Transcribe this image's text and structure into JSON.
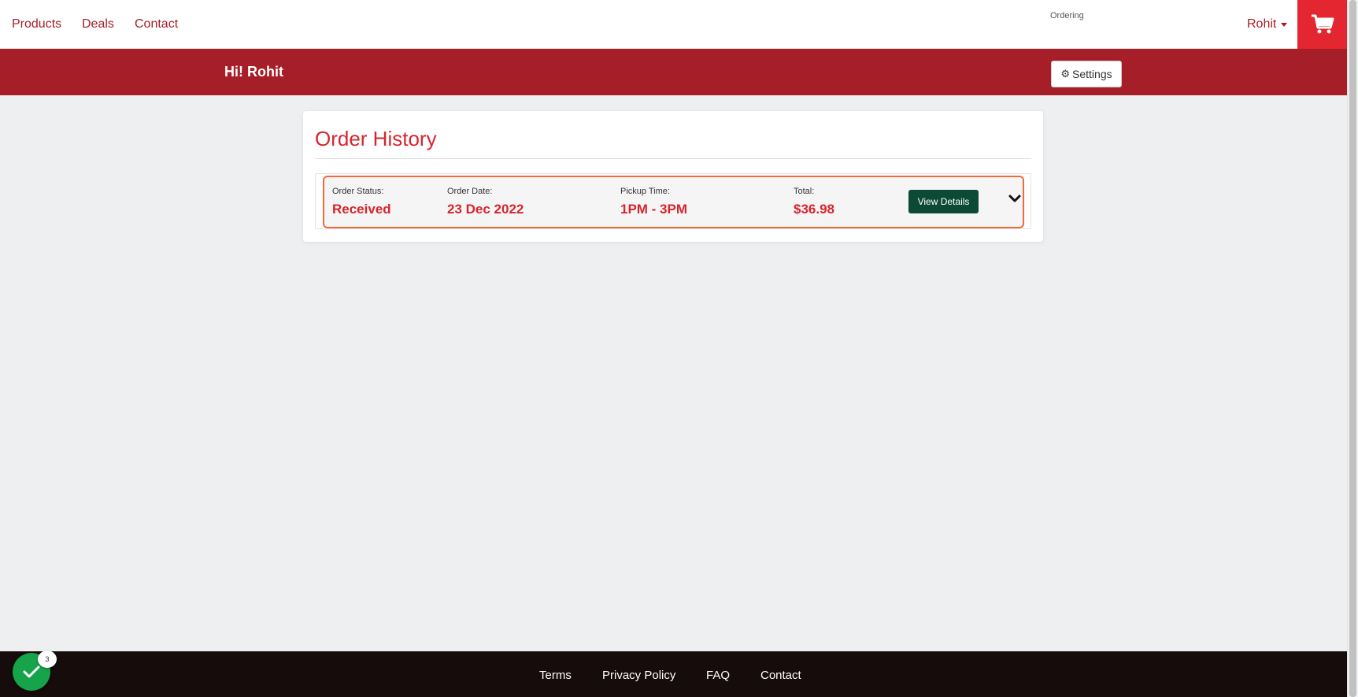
{
  "nav": {
    "links": [
      "Products",
      "Deals",
      "Contact"
    ],
    "ordering_label": "Ordering",
    "user_name": "Rohit",
    "cart_icon": "shopping-cart-icon"
  },
  "banner": {
    "greeting": "Hi! Rohit",
    "settings_label": "Settings"
  },
  "card": {
    "title": "Order History",
    "order": {
      "status_label": "Order Status:",
      "status_value": "Received",
      "date_label": "Order Date:",
      "date_value": "23 Dec 2022",
      "pickup_label": "Pickup Time:",
      "pickup_value": "1PM - 3PM",
      "total_label": "Total:",
      "total_value": "$36.98",
      "view_details_label": "View Details"
    }
  },
  "footer": {
    "links": [
      "Terms",
      "Privacy Policy",
      "FAQ",
      "Contact"
    ]
  },
  "widget": {
    "badge_count": "3"
  },
  "colors": {
    "brand_red": "#a61e27",
    "accent_red": "#d6252e",
    "cart_red": "#e3262f",
    "highlight_orange": "#f06a3b",
    "button_green": "#0c4a36",
    "footer_bg": "#150c0b",
    "widget_green": "#16a34a"
  }
}
